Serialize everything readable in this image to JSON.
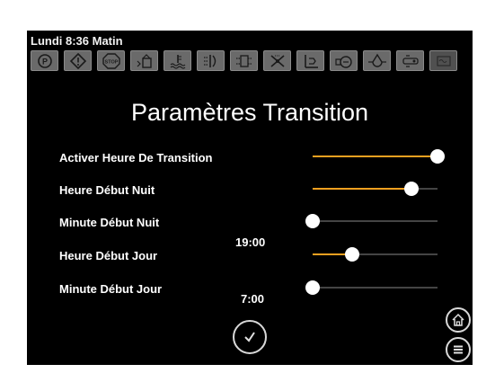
{
  "status": {
    "datetime": "Lundi 8:36 Matin"
  },
  "toolbar": {
    "icons": [
      "parking-brake-icon",
      "warning-icon",
      "stop-icon",
      "fuel-icon",
      "coolant-temp-icon",
      "air-filter-icon",
      "fuel-filter-icon",
      "fan-icon",
      "oil-level-icon",
      "oil-pressure-icon",
      "oil-drop-icon",
      "transmission-icon",
      "engine-icon"
    ]
  },
  "page": {
    "title": "Paramètres Transition"
  },
  "settings": [
    {
      "label": "Activer Heure De Transition",
      "level": 1.0
    },
    {
      "label": "Heure Début Nuit",
      "level": 0.79
    },
    {
      "label": "Minute Début Nuit",
      "level": 0.0
    },
    {
      "label": "Heure Début Jour",
      "level": 0.32
    },
    {
      "label": "Minute Début Jour",
      "level": 0.0
    }
  ],
  "values": {
    "night_start": "19:00",
    "day_start": "7:00"
  },
  "colors": {
    "accent": "#f0a020",
    "background": "#000000",
    "icon_button": "#6a6a6a"
  }
}
